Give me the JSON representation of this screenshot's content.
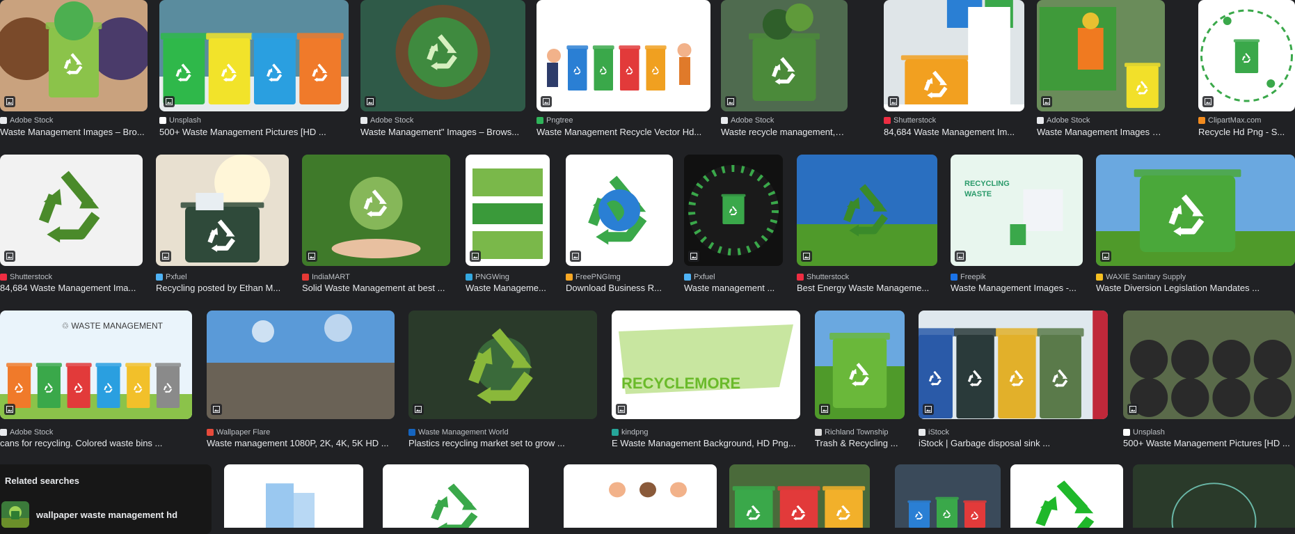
{
  "results": [
    {
      "source": "Adobe Stock",
      "title": "Waste Management Images – Bro...",
      "favicon_color": "#e8eaed"
    },
    {
      "source": "Unsplash",
      "title": "500+ Waste Management Pictures [HD ...",
      "favicon_color": "#ffffff"
    },
    {
      "source": "Adobe Stock",
      "title": "Waste Management\" Images – Brows...",
      "favicon_color": "#e8eaed"
    },
    {
      "source": "Pngtree",
      "title": "Waste Management Recycle Vector Hd...",
      "favicon_color": "#2fb45a"
    },
    {
      "source": "Adobe Stock",
      "title": "Waste recycle management, eco f...",
      "favicon_color": "#e8eaed"
    },
    {
      "source": "Shutterstock",
      "title": "84,684 Waste Management Im...",
      "favicon_color": "#ee2d42"
    },
    {
      "source": "Adobe Stock",
      "title": "Waste Management Images – Bro...",
      "favicon_color": "#e8eaed"
    },
    {
      "source": "ClipartMax.com",
      "title": "Recycle Hd Png - S...",
      "favicon_color": "#f28b1e"
    },
    {
      "source": "Shutterstock",
      "title": "84,684 Waste Management Ima...",
      "favicon_color": "#ee2d42"
    },
    {
      "source": "Pxfuel",
      "title": "Recycling posted by Ethan M...",
      "favicon_color": "#4fb3f6"
    },
    {
      "source": "IndiaMART",
      "title": "Solid Waste Management at best ...",
      "favicon_color": "#e53935"
    },
    {
      "source": "PNGWing",
      "title": "Waste Manageme...",
      "favicon_color": "#34a8e0"
    },
    {
      "source": "FreePNGImg",
      "title": "Download Business R...",
      "favicon_color": "#f9a825"
    },
    {
      "source": "Pxfuel",
      "title": "Waste management ...",
      "favicon_color": "#4fb3f6"
    },
    {
      "source": "Shutterstock",
      "title": "Best Energy Waste Manageme...",
      "favicon_color": "#ee2d42"
    },
    {
      "source": "Freepik",
      "title": "Waste Management Images -...",
      "favicon_color": "#1a73e8"
    },
    {
      "source": "WAXIE Sanitary Supply",
      "title": "Waste Diversion Legislation Mandates ...",
      "favicon_color": "#f6c022"
    },
    {
      "source": "Adobe Stock",
      "title": "cans for recycling. Colored waste bins ...",
      "favicon_color": "#e8eaed"
    },
    {
      "source": "Wallpaper Flare",
      "title": "Waste management 1080P, 2K, 4K, 5K HD ...",
      "favicon_color": "#e64a3b"
    },
    {
      "source": "Waste Management World",
      "title": "Plastics recycling market set to grow ...",
      "favicon_color": "#1565c0"
    },
    {
      "source": "kindpng",
      "title": "E Waste Management Background, HD Png...",
      "favicon_color": "#26a69a"
    },
    {
      "source": "Richland Township",
      "title": "Trash & Recycling ...",
      "favicon_color": "#dddddd"
    },
    {
      "source": "iStock",
      "title": "iStock | Garbage disposal sink ...",
      "favicon_color": "#e8eaed"
    },
    {
      "source": "Unsplash",
      "title": "500+ Waste Management Pictures [HD ...",
      "favicon_color": "#ffffff"
    }
  ],
  "related": {
    "heading": "Related searches",
    "items": [
      {
        "label": "wallpaper waste management hd"
      }
    ]
  }
}
